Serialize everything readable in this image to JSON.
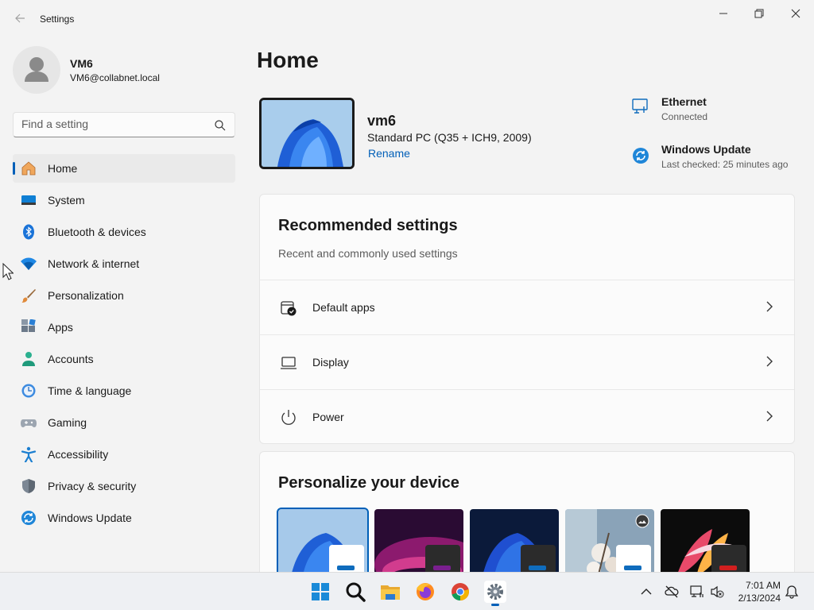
{
  "window": {
    "title": "Settings"
  },
  "user": {
    "name": "VM6",
    "email": "VM6@collabnet.local"
  },
  "search": {
    "placeholder": "Find a setting"
  },
  "nav": {
    "items": [
      {
        "label": "Home",
        "icon": "home-icon",
        "active": true
      },
      {
        "label": "System",
        "icon": "system-icon"
      },
      {
        "label": "Bluetooth & devices",
        "icon": "bluetooth-icon"
      },
      {
        "label": "Network & internet",
        "icon": "wifi-icon"
      },
      {
        "label": "Personalization",
        "icon": "brush-icon"
      },
      {
        "label": "Apps",
        "icon": "apps-icon"
      },
      {
        "label": "Accounts",
        "icon": "accounts-icon"
      },
      {
        "label": "Time & language",
        "icon": "time-language-icon"
      },
      {
        "label": "Gaming",
        "icon": "gamepad-icon"
      },
      {
        "label": "Accessibility",
        "icon": "accessibility-icon"
      },
      {
        "label": "Privacy & security",
        "icon": "shield-icon"
      },
      {
        "label": "Windows Update",
        "icon": "update-icon"
      }
    ]
  },
  "main": {
    "title": "Home",
    "device": {
      "name": "vm6",
      "model": "Standard PC (Q35 + ICH9, 2009)",
      "rename": "Rename"
    },
    "status": {
      "ethernet": {
        "title": "Ethernet",
        "sub": "Connected"
      },
      "update": {
        "title": "Windows Update",
        "sub": "Last checked: 25 minutes ago"
      }
    },
    "recommended": {
      "title": "Recommended settings",
      "subtitle": "Recent and commonly used settings",
      "rows": [
        {
          "label": "Default apps",
          "icon": "default-apps-icon"
        },
        {
          "label": "Display",
          "icon": "laptop-icon"
        },
        {
          "label": "Power",
          "icon": "power-icon"
        }
      ]
    },
    "personalize": {
      "title": "Personalize your device"
    }
  },
  "taskbar": {
    "time": "7:01 AM",
    "date": "2/13/2024"
  },
  "colors": {
    "accent": "#005fb8",
    "background": "#f3f3f3",
    "card": "#fbfbfb"
  }
}
